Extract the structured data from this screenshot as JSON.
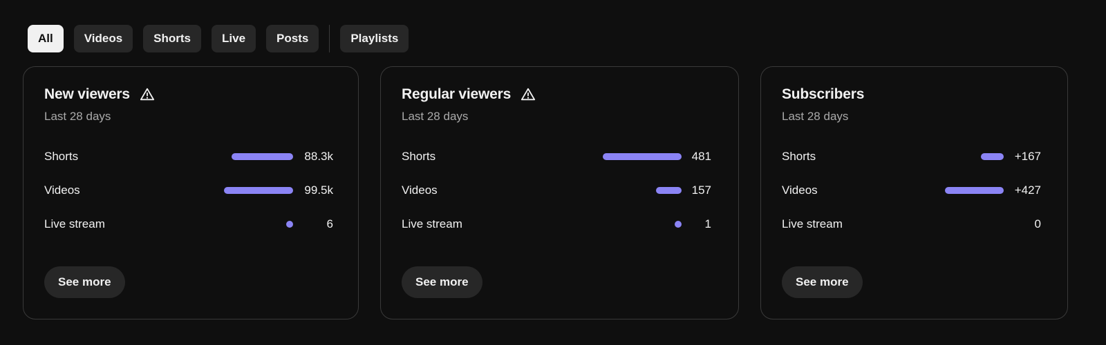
{
  "filters": {
    "chips": [
      "All",
      "Videos",
      "Shorts",
      "Live",
      "Posts"
    ],
    "playlists_label": "Playlists",
    "selected": "All"
  },
  "cards": [
    {
      "title": "New viewers",
      "has_warning": true,
      "icon": "warning-icon",
      "subtitle": "Last 28 days",
      "rows": [
        {
          "label": "Shorts",
          "value": "88.3k",
          "level": 0.887
        },
        {
          "label": "Videos",
          "value": "99.5k",
          "level": 1.0
        },
        {
          "label": "Live stream",
          "value": "6",
          "level": 0.0
        }
      ],
      "see_more": "See more"
    },
    {
      "title": "Regular viewers",
      "has_warning": true,
      "icon": "warning-icon",
      "subtitle": "Last 28 days",
      "rows": [
        {
          "label": "Shorts",
          "value": "481",
          "level": 1.0
        },
        {
          "label": "Videos",
          "value": "157",
          "level": 0.326
        },
        {
          "label": "Live stream",
          "value": "1",
          "level": 0.002
        }
      ],
      "see_more": "See more"
    },
    {
      "title": "Subscribers",
      "has_warning": false,
      "subtitle": "Last 28 days",
      "rows": [
        {
          "label": "Shorts",
          "value": "+167",
          "level": 0.391
        },
        {
          "label": "Videos",
          "value": "+427",
          "level": 1.0
        },
        {
          "label": "Live stream",
          "value": "0",
          "level": 0.0,
          "no_bar": true
        }
      ],
      "see_more": "See more"
    }
  ],
  "colors": {
    "background": "#0f0f0f",
    "bar": "#8b84f5",
    "chip_active": "#f1f1f1",
    "chip": "#272727",
    "card_border": "#3a3a3a"
  }
}
